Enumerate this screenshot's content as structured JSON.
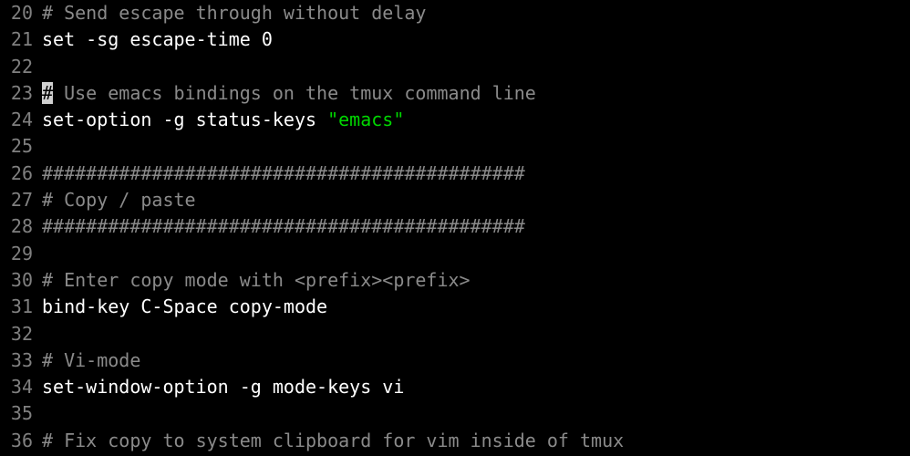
{
  "editor": {
    "lines": [
      {
        "num": "20",
        "tokens": [
          {
            "cls": "comment",
            "text": "# Send escape through without delay"
          }
        ]
      },
      {
        "num": "21",
        "tokens": [
          {
            "cls": "",
            "text": "set -sg escape-time 0"
          }
        ]
      },
      {
        "num": "22",
        "tokens": []
      },
      {
        "num": "23",
        "tokens": [
          {
            "cls": "cursor",
            "text": "#"
          },
          {
            "cls": "comment",
            "text": " Use emacs bindings on the tmux command line"
          }
        ]
      },
      {
        "num": "24",
        "tokens": [
          {
            "cls": "",
            "text": "set-option -g status-keys "
          },
          {
            "cls": "string",
            "text": "\"emacs\""
          }
        ]
      },
      {
        "num": "25",
        "tokens": []
      },
      {
        "num": "26",
        "tokens": [
          {
            "cls": "comment",
            "text": "############################################"
          }
        ]
      },
      {
        "num": "27",
        "tokens": [
          {
            "cls": "comment",
            "text": "# Copy / paste"
          }
        ]
      },
      {
        "num": "28",
        "tokens": [
          {
            "cls": "comment",
            "text": "############################################"
          }
        ]
      },
      {
        "num": "29",
        "tokens": []
      },
      {
        "num": "30",
        "tokens": [
          {
            "cls": "comment",
            "text": "# Enter copy mode with <prefix><prefix>"
          }
        ]
      },
      {
        "num": "31",
        "tokens": [
          {
            "cls": "",
            "text": "bind-key C-Space copy-mode"
          }
        ]
      },
      {
        "num": "32",
        "tokens": []
      },
      {
        "num": "33",
        "tokens": [
          {
            "cls": "comment",
            "text": "# Vi-mode"
          }
        ]
      },
      {
        "num": "34",
        "tokens": [
          {
            "cls": "",
            "text": "set-window-option -g mode-keys vi"
          }
        ]
      },
      {
        "num": "35",
        "tokens": []
      },
      {
        "num": "36",
        "tokens": [
          {
            "cls": "comment",
            "text": "# Fix copy to system clipboard for vim inside of tmux"
          }
        ]
      }
    ]
  }
}
